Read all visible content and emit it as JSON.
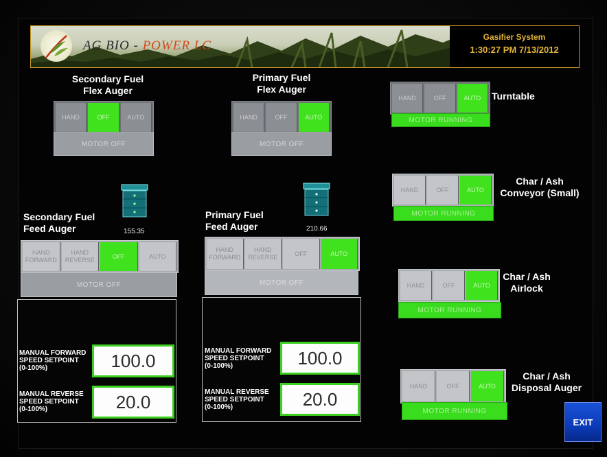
{
  "header": {
    "logo_text_a": "AG BIO - ",
    "logo_text_b": "POWER LC",
    "system_title": "Gasifier System",
    "datetime": "1:30:27 PM 7/13/2012"
  },
  "secondary_flex": {
    "title_line1": "Secondary Fuel",
    "title_line2": "Flex Auger",
    "buttons": [
      "HAND",
      "OFF",
      "AUTO"
    ],
    "selected": "OFF",
    "status": "MOTOR OFF"
  },
  "primary_flex": {
    "title_line1": "Primary Fuel",
    "title_line2": "Flex Auger",
    "buttons": [
      "HAND",
      "OFF",
      "AUTO"
    ],
    "selected": "AUTO",
    "status": "MOTOR OFF"
  },
  "turntable": {
    "title": "Turntable",
    "buttons": [
      "HAND",
      "OFF",
      "AUTO"
    ],
    "selected": "AUTO",
    "status": "MOTOR RUNNING"
  },
  "char_conveyor": {
    "title_line1": "Char / Ash",
    "title_line2": "Conveyor (Small)",
    "buttons": [
      "HAND",
      "OFF",
      "AUTO"
    ],
    "selected": "AUTO",
    "status": "MOTOR RUNNING"
  },
  "char_airlock": {
    "title_line1": "Char / Ash",
    "title_line2": "Airlock",
    "buttons": [
      "HAND",
      "OFF",
      "AUTO"
    ],
    "selected": "AUTO",
    "status": "MOTOR RUNNING"
  },
  "char_disposal": {
    "title_line1": "Char / Ash",
    "title_line2": "Disposal Auger",
    "buttons": [
      "HAND",
      "OFF",
      "AUTO"
    ],
    "selected": "AUTO",
    "status": "MOTOR RUNNING"
  },
  "secondary_feed": {
    "title_line1": "Secondary Fuel",
    "title_line2": "Feed Auger",
    "bin_value": "155.35",
    "buttons": [
      "HAND FORWARD",
      "HAND REVERSE",
      "OFF",
      "AUTO"
    ],
    "selected": "OFF",
    "status": "MOTOR OFF",
    "fwd_label": [
      "MANUAL FORWARD",
      "SPEED SETPOINT",
      "(0-100%)"
    ],
    "fwd_value": "100.0",
    "rev_label": [
      "MANUAL REVERSE",
      "SPEED SETPOINT",
      "(0-100%)"
    ],
    "rev_value": "20.0"
  },
  "primary_feed": {
    "title_line1": "Primary Fuel",
    "title_line2": "Feed Auger",
    "bin_value": "210.66",
    "buttons": [
      "HAND FORWARD",
      "HAND REVERSE",
      "OFF",
      "AUTO"
    ],
    "selected": "AUTO",
    "status": "MOTOR OFF",
    "fwd_label": [
      "MANUAL FORWARD",
      "SPEED SETPOINT",
      "(0-100%)"
    ],
    "fwd_value": "100.0",
    "rev_label": [
      "MANUAL REVERSE",
      "SPEED SETPOINT",
      "(0-100%)"
    ],
    "rev_value": "20.0"
  },
  "exit_label": "EXIT",
  "colors": {
    "active_green": "#3fe21d",
    "header_gold": "#e4b23a",
    "exit_blue": "#0b3bb8"
  }
}
